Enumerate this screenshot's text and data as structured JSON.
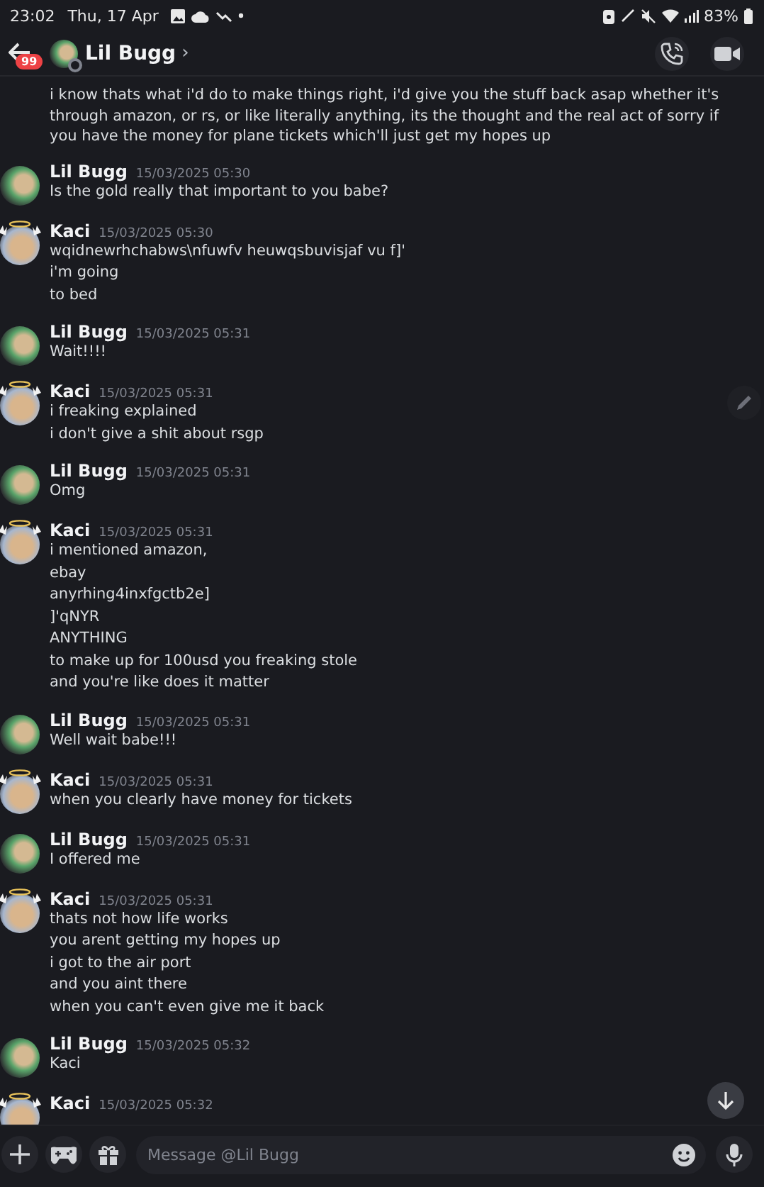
{
  "status_bar": {
    "time": "23:02",
    "date": "Thu, 17 Apr",
    "battery": "83%"
  },
  "header": {
    "back_badge": "99",
    "title": "Lil Bugg",
    "chevron": "›"
  },
  "messages": [
    {
      "kind": "continuation",
      "lines": [
        "i know thats what i'd do to make things right, i'd give you the stuff back asap whether it's through amazon, or rs, or like literally anything, its the thought and the real act of sorry if you have the money for plane tickets which'll just get my hopes up"
      ]
    },
    {
      "kind": "message",
      "author": "Lil Bugg",
      "time": "15/03/2025 05:30",
      "decorated": false,
      "lines": [
        "Is the gold really that important to you babe?"
      ]
    },
    {
      "kind": "message",
      "author": "Kaci",
      "time": "15/03/2025 05:30",
      "decorated": true,
      "lines": [
        "wqidnewrhchabws\\nfuwfv heuwqsbuvisjaf vu f]'",
        "i'm going",
        "to bed"
      ]
    },
    {
      "kind": "message",
      "author": "Lil Bugg",
      "time": "15/03/2025 05:31",
      "decorated": false,
      "lines": [
        "Wait!!!!"
      ]
    },
    {
      "kind": "message",
      "author": "Kaci",
      "time": "15/03/2025 05:31",
      "decorated": true,
      "lines": [
        "i freaking explained",
        "i don't give a shit about rsgp"
      ]
    },
    {
      "kind": "message",
      "author": "Lil Bugg",
      "time": "15/03/2025 05:31",
      "decorated": false,
      "lines": [
        "Omg"
      ]
    },
    {
      "kind": "message",
      "author": "Kaci",
      "time": "15/03/2025 05:31",
      "decorated": true,
      "lines": [
        "i mentioned amazon,",
        "ebay",
        "anyrhing4inxfgctb2e]",
        "]'qNYR",
        "ANYTHING",
        "to make up for 100usd you freaking stole",
        "and you're like does it matter"
      ]
    },
    {
      "kind": "message",
      "author": "Lil Bugg",
      "time": "15/03/2025 05:31",
      "decorated": false,
      "lines": [
        "Well wait babe!!!"
      ]
    },
    {
      "kind": "message",
      "author": "Kaci",
      "time": "15/03/2025 05:31",
      "decorated": true,
      "lines": [
        "when you clearly have money for tickets"
      ]
    },
    {
      "kind": "message",
      "author": "Lil Bugg",
      "time": "15/03/2025 05:31",
      "decorated": false,
      "lines": [
        "I offered me"
      ]
    },
    {
      "kind": "message",
      "author": "Kaci",
      "time": "15/03/2025 05:31",
      "decorated": true,
      "lines": [
        "thats not how life works",
        "you arent getting my hopes up",
        "i got to the air port",
        "and you aint there",
        "when you can't even give me it back"
      ]
    },
    {
      "kind": "message",
      "author": "Lil Bugg",
      "time": "15/03/2025 05:32",
      "decorated": false,
      "lines": [
        "Kaci"
      ]
    },
    {
      "kind": "message",
      "author": "Kaci",
      "time": "15/03/2025 05:32",
      "decorated": true
    }
  ],
  "composer": {
    "placeholder": "Message @Lil Bugg"
  }
}
